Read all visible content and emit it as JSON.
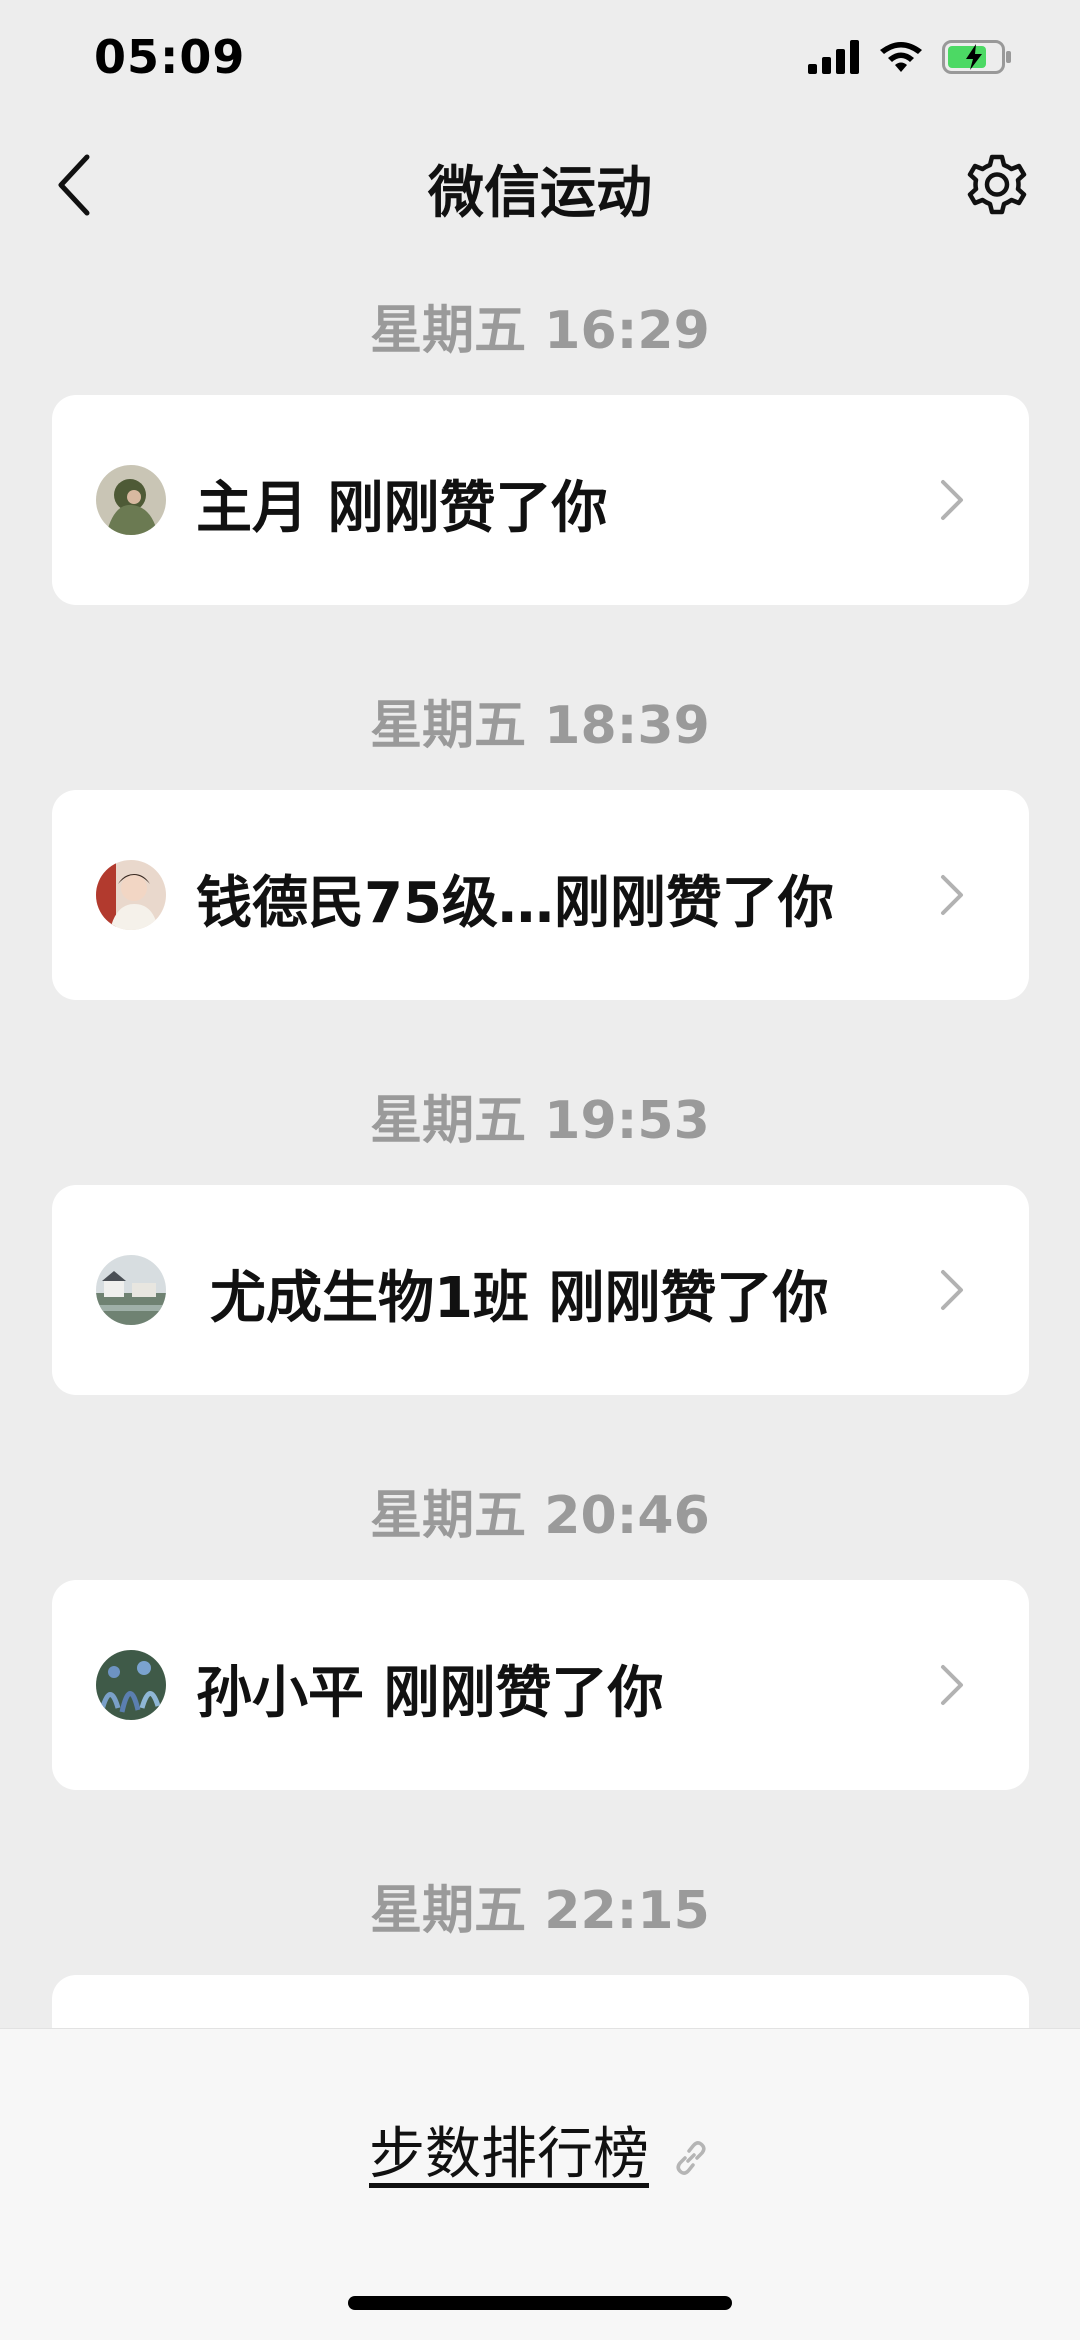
{
  "status_bar": {
    "time": "05:09"
  },
  "nav": {
    "title": "微信运动"
  },
  "feed": [
    {
      "time": "星期五 16:29",
      "text": "主月 刚刚赞了你",
      "avatar_color": "#6b7a52"
    },
    {
      "time": "星期五 18:39",
      "text": "钱德民75级…刚刚赞了你",
      "avatar_color": "#c79a86"
    },
    {
      "time": "星期五 19:53",
      "text": "尤成生物1班 刚刚赞了你",
      "avatar_color": "#8b9a8a"
    },
    {
      "time": "星期五 20:46",
      "text": "孙小平 刚刚赞了你",
      "avatar_color": "#4d6b55"
    },
    {
      "time": "星期五 22:15",
      "text": "",
      "avatar_color": ""
    }
  ],
  "bottom": {
    "rank_label": "步数排行榜"
  },
  "colors": {
    "background": "#ededed",
    "card": "#ffffff",
    "timestamp": "#9a9a9a",
    "battery_charge": "#4cd964"
  },
  "icons": [
    "back-arrow-icon",
    "gear-icon",
    "chevron-right-icon",
    "link-icon",
    "signal-icon",
    "wifi-icon",
    "battery-icon"
  ]
}
